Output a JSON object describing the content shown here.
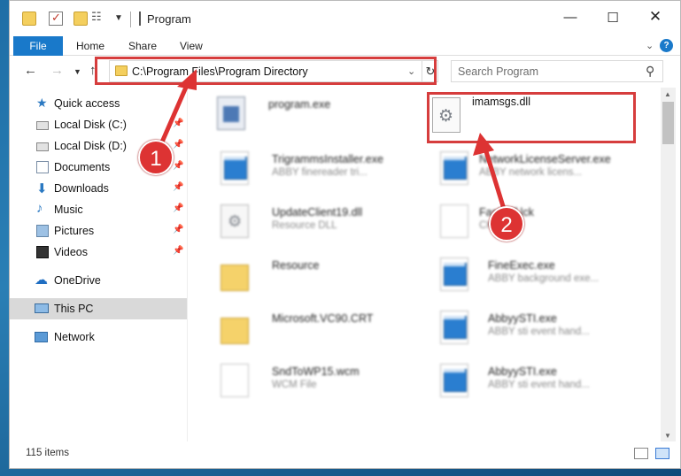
{
  "window": {
    "title": "Program"
  },
  "ribbon": {
    "tabs": [
      "File",
      "Home",
      "Share",
      "View"
    ]
  },
  "navigation": {
    "address_path": "C:\\Program Files\\Program Directory",
    "search_placeholder": "Search Program"
  },
  "sidebar": {
    "items": [
      {
        "label": "Quick access",
        "icon": "star-icon"
      },
      {
        "label": "Local Disk (C:)",
        "icon": "drive-icon"
      },
      {
        "label": "Local Disk (D:)",
        "icon": "drive-icon"
      },
      {
        "label": "Documents",
        "icon": "documents-icon"
      },
      {
        "label": "Downloads",
        "icon": "download-icon"
      },
      {
        "label": "Music",
        "icon": "music-icon"
      },
      {
        "label": "Pictures",
        "icon": "pictures-icon"
      },
      {
        "label": "Videos",
        "icon": "videos-icon"
      },
      {
        "label": "OneDrive",
        "icon": "cloud-icon"
      },
      {
        "label": "This PC",
        "icon": "computer-icon",
        "selected": true
      },
      {
        "label": "Network",
        "icon": "network-icon"
      }
    ]
  },
  "files": {
    "left": [
      {
        "name": "program.exe",
        "type": ""
      },
      {
        "name": "TrigrammsInstaller.exe",
        "type": "ABBY finereader tri..."
      },
      {
        "name": "UpdateClient19.dll",
        "type": "Resource DLL"
      },
      {
        "name": "Resource",
        "type": ""
      },
      {
        "name": "Microsoft.VC90.CRT",
        "type": ""
      },
      {
        "name": "SndToWP15.wcm",
        "type": "WCM File"
      }
    ],
    "right": [
      {
        "name": "imamsgs.dll",
        "type": ""
      },
      {
        "name": "NetworkLicenseServer.exe",
        "type": "ABBY network licens..."
      },
      {
        "name": "FastPdf.lck",
        "type": "CK File"
      },
      {
        "name": "FineExec.exe",
        "type": "ABBY background exe..."
      },
      {
        "name": "AbbyySTI.exe",
        "type": "ABBY sti event hand..."
      },
      {
        "name": "AbbyySTI.exe",
        "type": "ABBY sti event hand..."
      }
    ]
  },
  "status": {
    "item_count": "115 items"
  },
  "annotations": {
    "step_1": "1",
    "step_2": "2"
  },
  "colors": {
    "accent": "#1979ca",
    "highlight": "#d63d3d"
  }
}
